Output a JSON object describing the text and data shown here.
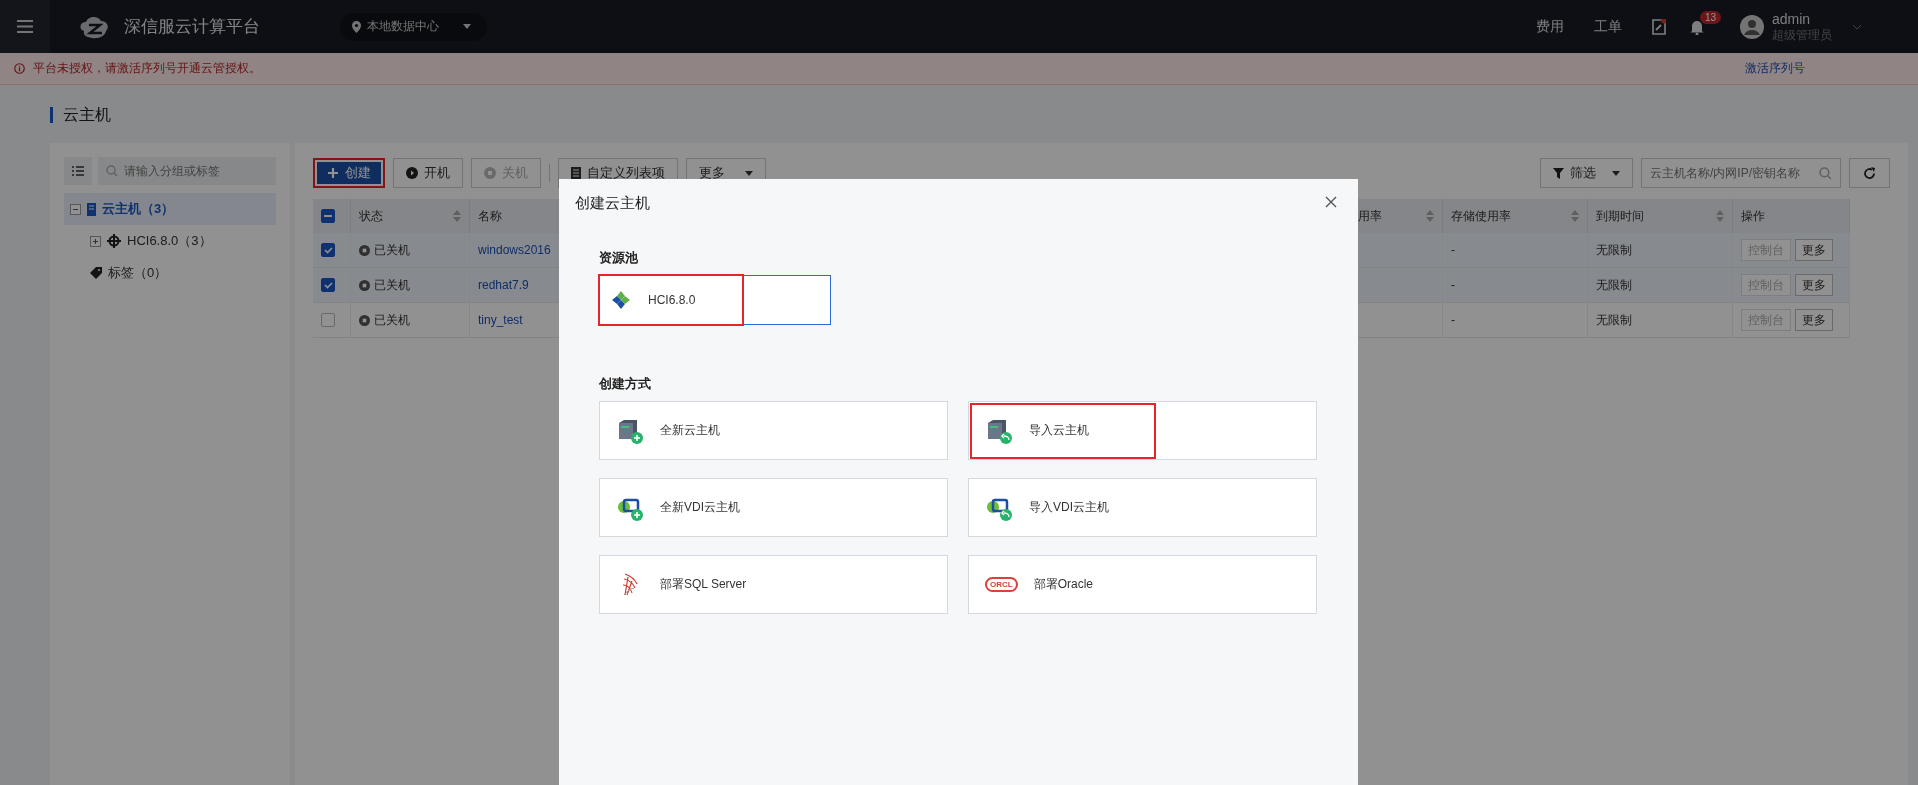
{
  "topbar": {
    "brand": "深信服云计算平台",
    "location": "本地数据中心",
    "links": [
      "费用",
      "工单"
    ],
    "notification_count": "13",
    "user": {
      "name": "admin",
      "role": "超级管理员"
    }
  },
  "banner": {
    "message": "平台未授权，请激活序列号开通云管授权。",
    "action": "激活序列号"
  },
  "page_title": "云主机",
  "sidebar": {
    "search_placeholder": "请输入分组或标签",
    "tree": [
      {
        "label": "云主机（3）",
        "selected": true,
        "expanded": true,
        "children": [
          {
            "label": "HCI6.8.0（3）",
            "selected": false,
            "expanded": false
          }
        ]
      },
      {
        "label": "标签（0）",
        "selected": false
      }
    ]
  },
  "toolbar": {
    "buttons": [
      {
        "label": "创建",
        "kind": "primary",
        "disabled": false,
        "highlighted": true
      },
      {
        "label": "开机",
        "kind": "play",
        "disabled": false,
        "highlighted": false
      },
      {
        "label": "关机",
        "kind": "stop",
        "disabled": true,
        "highlighted": false
      },
      {
        "label": "自定义列表项",
        "kind": "columns",
        "disabled": false,
        "highlighted": false
      },
      {
        "label": "更多",
        "kind": "dropdown",
        "disabled": false,
        "highlighted": false
      }
    ],
    "filter": "筛选",
    "search_placeholder": "云主机名称/内网IP/密钥名称"
  },
  "table": {
    "select_all_partial": true,
    "columns": [
      {
        "label": "状态",
        "sortable": true
      },
      {
        "label": "名称"
      },
      {
        "label": "用率",
        "sortable": true
      },
      {
        "label": "存储使用率",
        "sortable": true
      },
      {
        "label": "到期时间",
        "sortable": true
      },
      {
        "label": "操作",
        "sortable": false
      }
    ],
    "rows": [
      {
        "checked": true,
        "status": "已关机",
        "name": "windows2016",
        "storage": "-",
        "expiry": "无限制",
        "actions": [
          "控制台",
          "更多"
        ]
      },
      {
        "checked": true,
        "status": "已关机",
        "name": "redhat7.9",
        "storage": "-",
        "expiry": "无限制",
        "actions": [
          "控制台",
          "更多"
        ]
      },
      {
        "checked": false,
        "status": "已关机",
        "name": "tiny_test",
        "storage": "-",
        "expiry": "无限制",
        "actions": [
          "控制台",
          "更多"
        ]
      }
    ]
  },
  "dialog": {
    "title": "创建云主机",
    "pool_label": "资源池",
    "pool": {
      "label": "HCI6.8.0",
      "selected": true,
      "highlighted": true
    },
    "method_label": "创建方式",
    "methods": [
      {
        "label": "全新云主机",
        "kind": "server-new",
        "highlighted": false
      },
      {
        "label": "导入云主机",
        "kind": "server-import",
        "highlighted": true
      },
      {
        "label": "全新VDI云主机",
        "kind": "vdi-new",
        "highlighted": false
      },
      {
        "label": "导入VDI云主机",
        "kind": "vdi-import",
        "highlighted": false
      },
      {
        "label": "部署SQL Server",
        "kind": "sql",
        "highlighted": false
      },
      {
        "label": "部署Oracle",
        "kind": "oracle",
        "logo_text": "ORCL",
        "highlighted": false
      }
    ]
  }
}
